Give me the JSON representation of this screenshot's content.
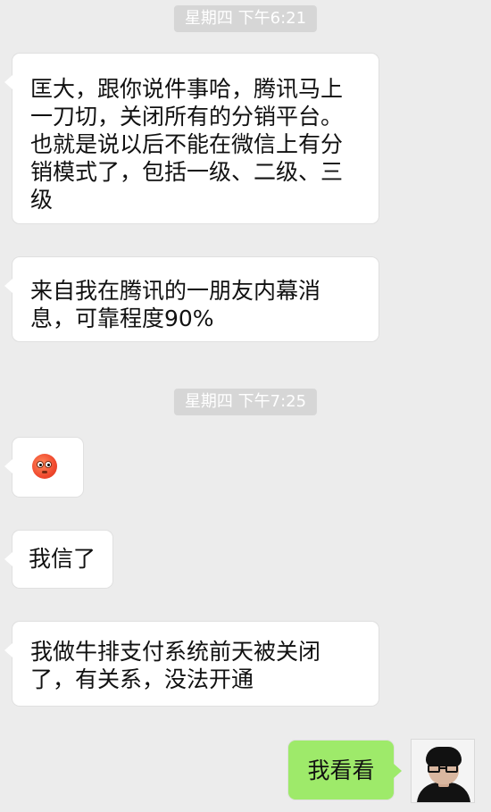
{
  "chat": {
    "timestamps": [
      "星期四 下午6:21",
      "星期四 下午7:25"
    ],
    "messages": [
      {
        "text": "匡大，跟你说件事哈，腾讯马上一刀切，关闭所有的分销平台。也就是说以后不能在微信上有分销模式了，包括一级、二级、三级"
      },
      {
        "text": "来自我在腾讯的一朋友内幕消息，可靠程度90%"
      },
      {
        "icon": "flushed-face-emoji"
      },
      {
        "text": "我信了"
      },
      {
        "text": "我做牛排支付系统前天被关闭了，有关系，没法开通"
      },
      {
        "text": "我看看"
      }
    ]
  },
  "colors": {
    "background": "#ececec",
    "incoming_bubble": "#ffffff",
    "outgoing_bubble": "#9eea6a",
    "timestamp_bg": "#d6d6d6"
  }
}
